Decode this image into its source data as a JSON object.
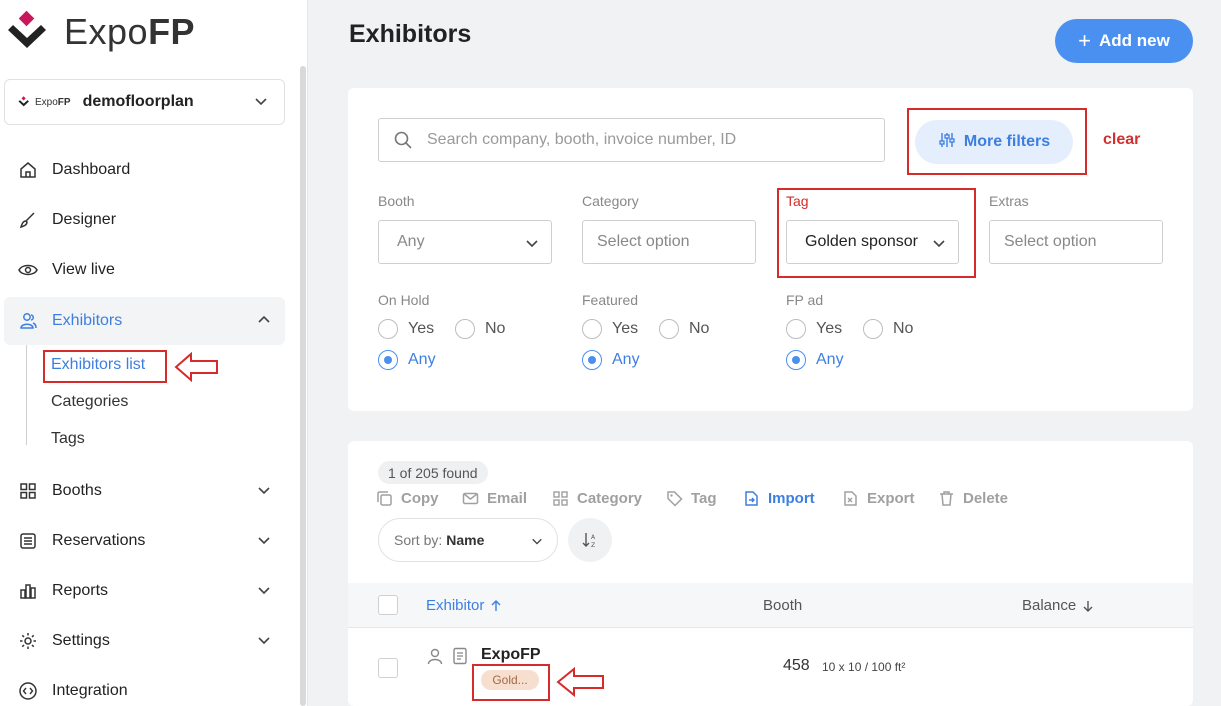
{
  "brand": {
    "name_light": "Expo",
    "name_bold": "FP",
    "mini_light": "Expo",
    "mini_bold": "FP"
  },
  "workspace": {
    "name": "demofloorplan"
  },
  "nav": {
    "dashboard": "Dashboard",
    "designer": "Designer",
    "view_live": "View live",
    "exhibitors": "Exhibitors",
    "exhibitors_list": "Exhibitors list",
    "categories": "Categories",
    "tags": "Tags",
    "booths": "Booths",
    "reservations": "Reservations",
    "reports": "Reports",
    "settings": "Settings",
    "integration": "Integration"
  },
  "header": {
    "title": "Exhibitors",
    "add_label": "Add new"
  },
  "filters": {
    "search_placeholder": "Search company, booth, invoice number, ID",
    "more_filters": "More filters",
    "clear": "clear",
    "booth": {
      "label": "Booth",
      "value": "Any"
    },
    "category": {
      "label": "Category",
      "placeholder": "Select option"
    },
    "tag": {
      "label": "Tag",
      "value": "Golden sponsor"
    },
    "extras": {
      "label": "Extras",
      "placeholder": "Select option"
    },
    "on_hold": {
      "label": "On Hold",
      "yes": "Yes",
      "no": "No",
      "any": "Any"
    },
    "featured": {
      "label": "Featured",
      "yes": "Yes",
      "no": "No",
      "any": "Any"
    },
    "fp_ad": {
      "label": "FP ad",
      "yes": "Yes",
      "no": "No",
      "any": "Any"
    }
  },
  "results": {
    "found": "1 of 205 found",
    "actions": {
      "copy": "Copy",
      "email": "Email",
      "category": "Category",
      "tag": "Tag",
      "import": "Import",
      "export": "Export",
      "delete": "Delete"
    },
    "sort": {
      "prefix": "Sort by:",
      "value": "Name"
    },
    "columns": {
      "exhibitor": "Exhibitor",
      "booth": "Booth",
      "balance": "Balance"
    },
    "rows": [
      {
        "name": "ExpoFP",
        "booth": "458",
        "size": "10 x 10 / 100 ft²",
        "tag": "Gold..."
      }
    ]
  },
  "colors": {
    "accent": "#4a90f0",
    "highlight": "#d72a2a",
    "brand": "#c8175d"
  }
}
